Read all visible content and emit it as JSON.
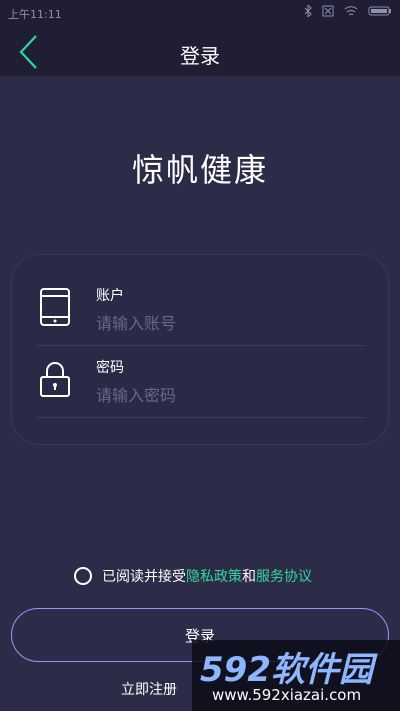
{
  "status_bar": {
    "time": "上午11:11"
  },
  "header": {
    "title": "登录",
    "back_icon": "chevron-left-icon"
  },
  "app": {
    "name": "惊帆健康"
  },
  "form": {
    "account": {
      "label": "账户",
      "placeholder": "请输入账号",
      "icon": "phone-icon"
    },
    "password": {
      "label": "密码",
      "placeholder": "请输入密码",
      "icon": "lock-icon"
    }
  },
  "terms": {
    "prefix": "已阅读并接受",
    "privacy": "隐私政策",
    "and": "和",
    "service": "服务协议"
  },
  "actions": {
    "login": "登录",
    "register": "立即注册"
  },
  "watermark": {
    "big": "592软件园",
    "small": "www.592xiazai.com"
  },
  "colors": {
    "accent": "#32d79d",
    "background": "#2d2c48",
    "header": "#1f1e34"
  }
}
